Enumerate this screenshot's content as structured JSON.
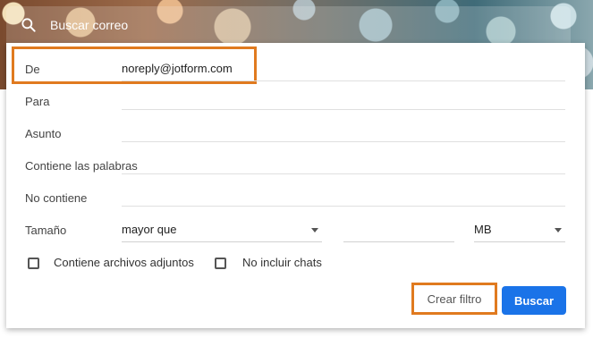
{
  "search": {
    "placeholder": "Buscar correo"
  },
  "filter": {
    "fields": [
      {
        "label": "De",
        "value": "noreply@jotform.com"
      },
      {
        "label": "Para",
        "value": ""
      },
      {
        "label": "Asunto",
        "value": ""
      },
      {
        "label": "Contiene las palabras",
        "value": ""
      },
      {
        "label": "No contiene",
        "value": ""
      }
    ],
    "size": {
      "label": "Tamaño",
      "comparator": "mayor que",
      "value": "",
      "unit": "MB"
    },
    "checkboxes": [
      {
        "label": "Contiene archivos adjuntos",
        "checked": false
      },
      {
        "label": "No incluir chats",
        "checked": false
      }
    ],
    "create_filter_label": "Crear filtro",
    "search_label": "Buscar"
  },
  "colors": {
    "highlight": "#e07a1f",
    "primary_button": "#1a73e8"
  }
}
